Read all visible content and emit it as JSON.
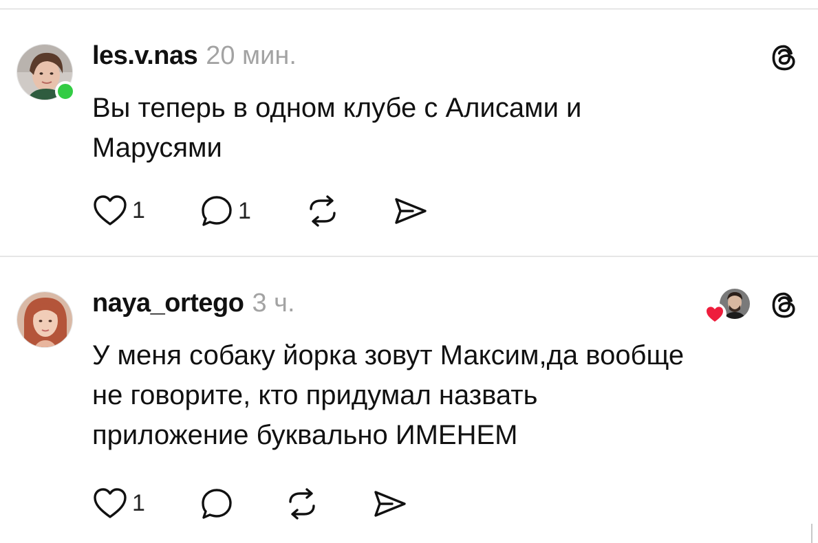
{
  "posts": [
    {
      "username": "les.v.nas",
      "time": "20 мин.",
      "online": true,
      "text_lines": [
        "Вы теперь в одном клубе с Алисами и",
        "Марусями"
      ],
      "likes": "1",
      "replies": "1",
      "icons": {
        "like": "heart-icon",
        "reply": "comment-bubble-icon",
        "repost": "repost-icon",
        "share": "send-icon",
        "app": "threads-logo-icon"
      }
    },
    {
      "username": "naya_ortego",
      "time": "3 ч.",
      "online": false,
      "liked_by_author": true,
      "text_lines": [
        "У меня собаку йорка зовут Максим,да вообще",
        "не говорите, кто придумал назвать",
        "приложение буквально ИМЕНЕМ"
      ],
      "likes": "1",
      "replies": "",
      "icons": {
        "like": "heart-icon",
        "reply": "comment-bubble-icon",
        "repost": "repost-icon",
        "share": "send-icon",
        "app": "threads-logo-icon"
      }
    }
  ],
  "colors": {
    "online": "#33cc44",
    "heart_badge": "#ee1d3c",
    "muted": "#a3a3a3",
    "divider": "#e6e6e6"
  }
}
